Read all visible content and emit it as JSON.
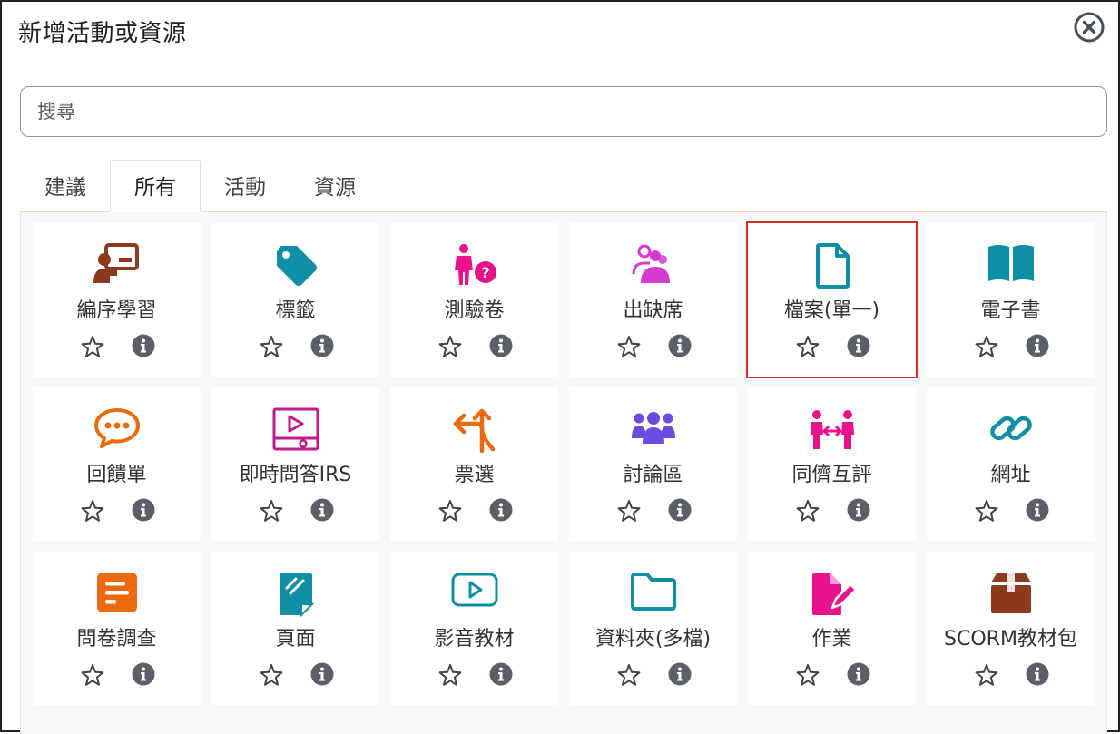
{
  "dialog": {
    "title": "新增活動或資源",
    "close_icon": "close-circle-icon"
  },
  "search": {
    "placeholder": "搜尋",
    "value": ""
  },
  "tabs": [
    {
      "label": "建議",
      "active": false
    },
    {
      "label": "所有",
      "active": true
    },
    {
      "label": "活動",
      "active": false
    },
    {
      "label": "資源",
      "active": false
    }
  ],
  "modules": [
    {
      "label": "編序學習",
      "icon": "lesson-presenter-icon",
      "color": "#8b3a1e"
    },
    {
      "label": "標籤",
      "icon": "tag-icon",
      "color": "#0f8fa3"
    },
    {
      "label": "測驗卷",
      "icon": "quiz-person-question-icon",
      "color": "#e8128c"
    },
    {
      "label": "出缺席",
      "icon": "attendance-people-icon",
      "color": "#d63bd0"
    },
    {
      "label": "檔案(單一)",
      "icon": "file-icon",
      "color": "#0f8fa3",
      "selected": true
    },
    {
      "label": "電子書",
      "icon": "book-icon",
      "color": "#0f8fa3"
    },
    {
      "label": "回饋單",
      "icon": "feedback-chat-icon",
      "color": "#ea6a0c"
    },
    {
      "label": "即時問答IRS",
      "icon": "video-slide-icon",
      "color": "#c2188a"
    },
    {
      "label": "票選",
      "icon": "choice-arrows-icon",
      "color": "#ea6a0c"
    },
    {
      "label": "討論區",
      "icon": "forum-group-icon",
      "color": "#6a4ce0"
    },
    {
      "label": "同儕互評",
      "icon": "peer-review-icon",
      "color": "#e8128c"
    },
    {
      "label": "網址",
      "icon": "link-icon",
      "color": "#0f8fa3"
    },
    {
      "label": "問卷調查",
      "icon": "survey-list-icon",
      "color": "#ea6a0c"
    },
    {
      "label": "頁面",
      "icon": "page-icon",
      "color": "#0f8fa3"
    },
    {
      "label": "影音教材",
      "icon": "video-play-icon",
      "color": "#0f8fa3"
    },
    {
      "label": "資料夾(多檔)",
      "icon": "folder-icon",
      "color": "#0f8fa3"
    },
    {
      "label": "作業",
      "icon": "assignment-edit-icon",
      "color": "#e8128c"
    },
    {
      "label": "SCORM教材包",
      "icon": "package-box-icon",
      "color": "#8b3a1e"
    }
  ]
}
